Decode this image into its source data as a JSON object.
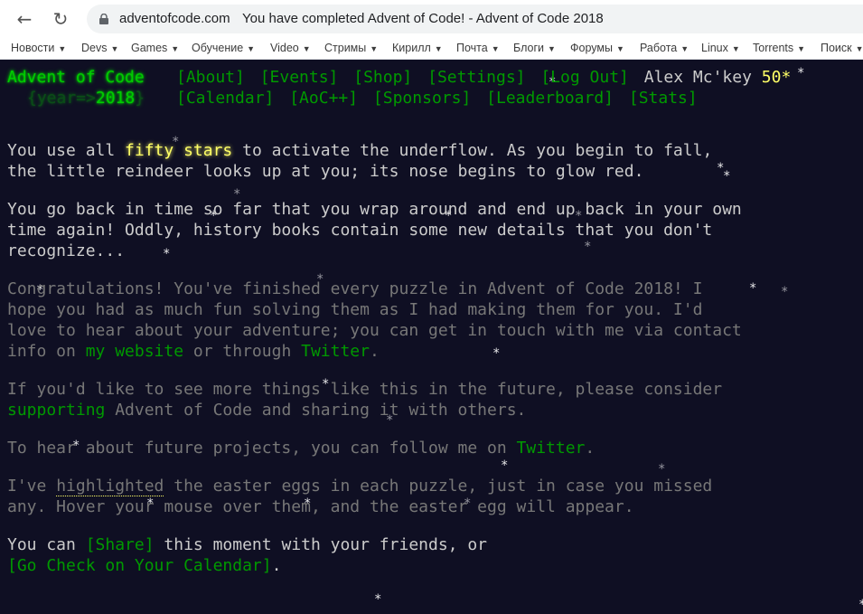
{
  "browser": {
    "url_domain": "adventofcode.com",
    "tab_title": "You have completed Advent of Code! - Advent of Code 2018",
    "bookmarks": [
      "Новости",
      "Devs",
      "Games",
      "Обучение",
      "Video",
      "Стримы",
      "Кирилл",
      "Почта",
      "Блоги",
      "Форумы",
      "Работа",
      "Linux",
      "Torrents",
      "Поиск"
    ]
  },
  "header": {
    "logo": "Advent of Code",
    "year_prefix": "{year=>",
    "year": "2018",
    "year_suffix": "}",
    "nav_row1": [
      "[About]",
      "[Events]",
      "[Shop]",
      "[Settings]",
      "[Log Out]"
    ],
    "nav_row2": [
      "[Calendar]",
      "[AoC++]",
      "[Sponsors]",
      "[Leaderboard]",
      "[Stats]"
    ],
    "user": "Alex Mc'key",
    "stars": "50*"
  },
  "content": {
    "p1_before": "You use all ",
    "p1_highlight": "fifty stars",
    "p1_after_line1": " to activate the underflow. As you begin to fall,",
    "p1_line2": "the little reindeer looks up at you; its nose begins to glow red.",
    "p2_line1": "You go back in time so far that you wrap around and end up back in your own",
    "p2_line2": "time again! Oddly, history books contain some new details that you don't",
    "p2_line3": "recognize...",
    "p3_line1": "Congratulations! You've finished every puzzle in Advent of Code 2018! I",
    "p3_line2": "hope you had as much fun solving them as I had making them for you. I'd",
    "p3_line3": "love to hear about your adventure; you can get in touch with me via contact",
    "p3_line4_pre": "info on ",
    "p3_link1": "my website",
    "p3_line4_mid": " or through ",
    "p3_link2": "Twitter",
    "p3_line4_end": ".",
    "p4_line1": "If you'd like to see more things like this in the future, please consider",
    "p4_link": "supporting",
    "p4_line2_after": " Advent of Code and sharing it with others.",
    "p5_pre": "To hear about future projects, you can follow me on ",
    "p5_link": "Twitter",
    "p5_end": ".",
    "p6_pre": "I've ",
    "p6_highlight": "highlighted",
    "p6_line1_after": " the easter eggs in each puzzle, just in case you missed",
    "p6_line2": "any. Hover your mouse over them, and the easter egg will appear.",
    "p7_line1_pre": "You can ",
    "p7_share": "[Share]",
    "p7_line1_after": " this moment with your friends, or",
    "p7_calendar": "[Go Check on Your Calendar]",
    "p7_end": "."
  },
  "decor": {
    "snowflake_glyph": "*",
    "snowflake_count": 26
  }
}
